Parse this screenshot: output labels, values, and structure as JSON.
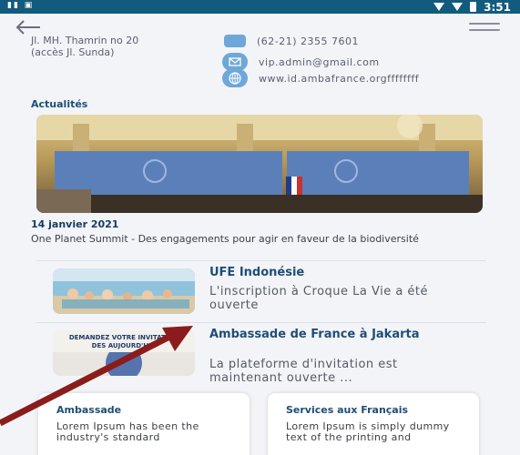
{
  "status": {
    "left_icons": "▮▮ ▣",
    "time": "3:51"
  },
  "header": {
    "back_icon": "back-arrow-icon",
    "menu_icon": "hamburger-icon"
  },
  "contact": {
    "address_line1": "Jl. MH. Thamrin no 20",
    "address_line2": "(accès Jl. Sunda)",
    "phone": "(62-21) 2355 7601",
    "email": "vip.admin@gmail.com",
    "website": "www.id.ambafrance.orgffffffff"
  },
  "news": {
    "section_title": "Actualités",
    "featured_date": "14 janvier 2021",
    "featured_text": "One Planet Summit - Des engagements pour agir en faveur de la biodiversité",
    "items": [
      {
        "title": "UFE Indonésie",
        "desc": "L'inscription à Croque La Vie a été ouverte"
      },
      {
        "title": "Ambassade de France à Jakarta",
        "desc": "La plateforme d'invitation est maintenant ouverte ...",
        "thumb_text": "DEMANDEZ VOTRE INVITATION DES AUJOURD'HUI"
      }
    ]
  },
  "tiles": [
    {
      "title": "Ambassade",
      "desc": "Lorem Ipsum has been the industry's standard"
    },
    {
      "title": "Services aux Français",
      "desc": "Lorem Ipsum is simply dummy text of the printing and"
    }
  ],
  "colors": {
    "status_bar": "#135b7e",
    "accent": "#1f4d78",
    "annotation_arrow": "#8b1c1c"
  }
}
